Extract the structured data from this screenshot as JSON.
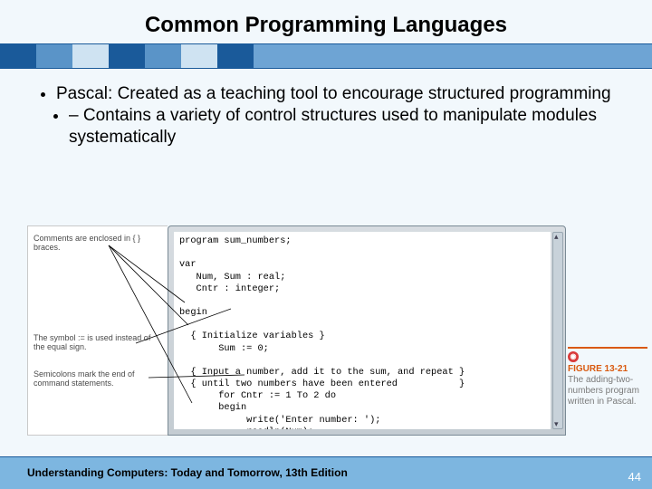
{
  "title": "Common Programming Languages",
  "bullet_main": "Pascal: Created as a teaching tool to encourage structured programming",
  "bullet_sub": "Contains a variety of control structures used to manipulate modules systematically",
  "annotations": {
    "a1": "Comments are enclosed in { } braces.",
    "a2": "The symbol := is used instead of the equal sign.",
    "a3": "Semicolons mark the end of command statements."
  },
  "code": "program sum_numbers;\n\nvar\n   Num, Sum : real;\n   Cntr : integer;\n\nbegin\n\n  { Initialize variables }\n       Sum := 0;\n\n  { Input a number, add it to the sum, and repeat }\n  { until two numbers have been entered           }\n       for Cntr := 1 To 2 do\n       begin\n            write('Enter number: ');\n            readln(Num);\n            Sum:= Sum + Num;\n       end;\n\n  { Print the sum }\n       writeln('The sum of the numbers you entered is ',Sum);\nend.",
  "caption": {
    "label": "FIGURE 13-21",
    "text": "The adding-two-numbers program written in Pascal."
  },
  "footer": "Understanding Computers: Today and Tomorrow, 13th Edition",
  "page": "44"
}
